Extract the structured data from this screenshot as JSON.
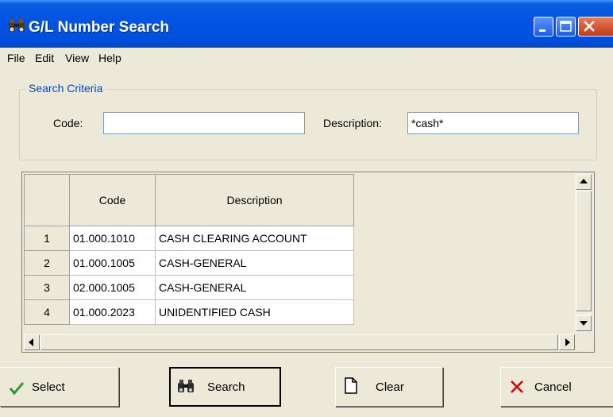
{
  "window": {
    "title": "G/L Number Search"
  },
  "menu": [
    "File",
    "Edit",
    "View",
    "Help"
  ],
  "search_criteria": {
    "legend": "Search Criteria",
    "code_label": "Code:",
    "code_value": "",
    "description_label": "Description:",
    "description_value": "*cash*"
  },
  "grid": {
    "columns": [
      "Code",
      "Description"
    ],
    "rows": [
      {
        "num": "1",
        "code": "01.000.1010",
        "description": "CASH CLEARING ACCOUNT"
      },
      {
        "num": "2",
        "code": "01.000.1005",
        "description": "CASH-GENERAL"
      },
      {
        "num": "3",
        "code": "02.000.1005",
        "description": "CASH-GENERAL"
      },
      {
        "num": "4",
        "code": "01.000.2023",
        "description": "UNIDENTIFIED CASH"
      }
    ]
  },
  "buttons": {
    "select": "Select",
    "search": "Search",
    "clear": "Clear",
    "cancel": "Cancel"
  },
  "icons": {
    "title": "binoculars-icon",
    "select": "checkmark-icon",
    "search": "binoculars-icon",
    "clear": "blank-document-icon",
    "cancel": "x-icon"
  },
  "colors": {
    "titlebar": "#0054e3",
    "legend": "#0046d5",
    "checkmark": "#2e9b2e",
    "cancel_x": "#d40000"
  }
}
